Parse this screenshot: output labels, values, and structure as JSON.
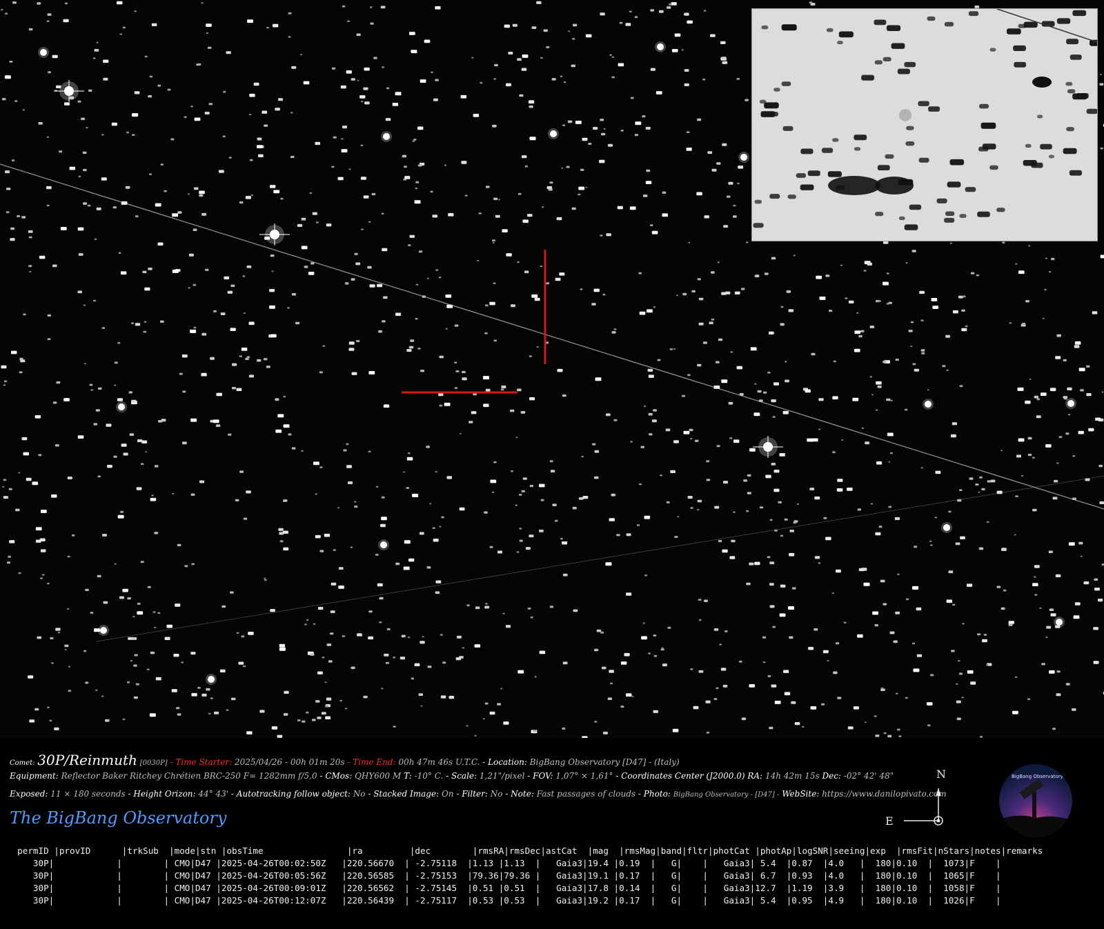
{
  "caption": {
    "line1": {
      "comet_label": "Comet:",
      "comet_name": "30P/Reinmuth",
      "comet_code": "[0030P]",
      "time_start_label": "- Time Starter:",
      "time_start_value": "2025/04/26 - 00h 01m 20s",
      "time_end_label": "- Time End:",
      "time_end_value": "00h 47m 46s U.T.C.",
      "location_label": "- Location:",
      "location_value": "BigBang Observatory [D47] - (Italy)"
    },
    "line2": {
      "equipment_label": "Equipment:",
      "equipment_value": "Reflector Baker Ritchey Chrétien BRC-250 F= 1282mm f/5,0",
      "cmos_label": "- CMos:",
      "cmos_value": "QHY600 M",
      "temp_label": "T:",
      "temp_value": "-10° C.",
      "scale_label": "- Scale:",
      "scale_value": "1,21\"/pixel",
      "fov_label": "- FOV:",
      "fov_value": "1,07° × 1,61°",
      "coord_label": "- Coordinates Center (J2000.0) RA:",
      "ra_value": "14h 42m 15s",
      "dec_label": "Dec:",
      "dec_value": "-02° 42' 48\""
    },
    "line3": {
      "exposed_label": "Exposed:",
      "exposed_value": "11 × 180 seconds",
      "height_label": "- Height Orizon:",
      "height_value": "44° 43'",
      "autotrack_label": "- Autotracking follow object:",
      "autotrack_value": "No",
      "stacked_label": "- Stacked Image:",
      "stacked_value": "On",
      "filter_label": "- Filter:",
      "filter_value": "No",
      "note_label": "- Note:",
      "note_value": "Fast passages of clouds",
      "photo_label": "- Photo:",
      "photo_value": "BigBang Observatory - [D47] -",
      "website_label": "WebSite:",
      "website_value": "https://www.danilopivato.com"
    }
  },
  "brand": "The BigBang Observatory",
  "compass": {
    "north": "N",
    "east": "E"
  },
  "logo_text": "BigBang Observatory [BBO] - D47",
  "table": {
    "header": "  permID |provID      |trkSub  |mode|stn |obsTime                |ra         |dec        |rmsRA|rmsDec|astCat  |mag  |rmsMag|band|fltr|photCat |photAp|logSNR|seeing|exp  |rmsFit|nStars|notes|remarks",
    "rows": [
      "     30P|            |        | CMO|D47 |2025-04-26T00:02:50Z   |220.56670  | -2.75118  |1.13 |1.13  |   Gaia3|19.4 |0.19  |   G|    |   Gaia3| 5.4  |0.87  |4.0   |  180|0.10  |  1073|F    |",
      "     30P|            |        | CMO|D47 |2025-04-26T00:05:56Z   |220.56585  | -2.75153  |79.36|79.36 |   Gaia3|19.1 |0.17  |   G|    |   Gaia3| 6.7  |0.93  |4.0   |  180|0.10  |  1065|F    |",
      "     30P|            |        | CMO|D47 |2025-04-26T00:09:01Z   |220.56562  | -2.75145  |0.51 |0.51  |   Gaia3|17.8 |0.14  |   G|    |   Gaia3|12.7  |1.19  |3.9   |  180|0.10  |  1058|F    |",
      "     30P|            |        | CMO|D47 |2025-04-26T00:12:07Z   |220.56439  | -2.75117  |0.53 |0.53  |   Gaia3|19.2 |0.17  |   G|    |   Gaia3| 5.4  |0.95  |4.9   |  180|0.10  |  1026|F    |"
    ]
  },
  "colors": {
    "background": "#000000",
    "marker": "#d01818",
    "brand": "#4f9cff",
    "label_red": "#ff2b2b"
  }
}
